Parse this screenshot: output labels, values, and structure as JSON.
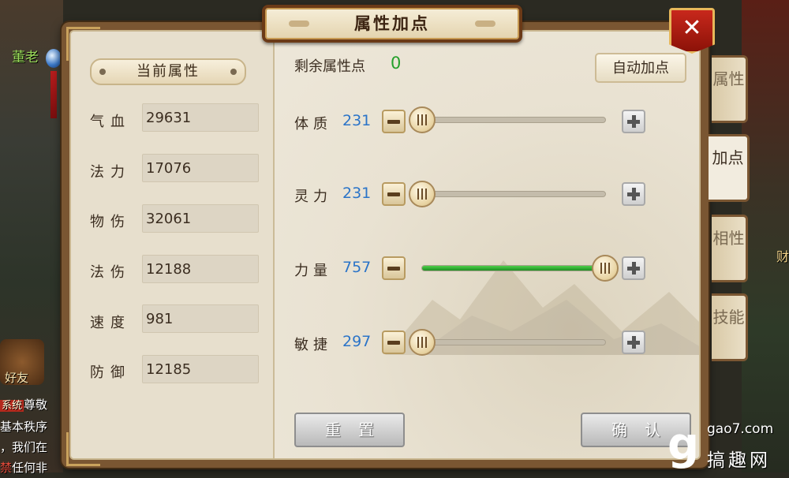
{
  "world": {
    "npc_name": "董老",
    "friend_label": "好友",
    "chat_lines": [
      {
        "tag": "系统",
        "text": "尊敬"
      },
      {
        "tag": "",
        "text": "基本秩序"
      },
      {
        "tag": "",
        "text": "，我们在"
      },
      {
        "tag": "禁",
        "text": "任何非"
      }
    ],
    "right_name": "财"
  },
  "title": "属性加点",
  "current_attrs": {
    "header": "当前属性",
    "items": [
      {
        "label": "气血",
        "value": "29631"
      },
      {
        "label": "法力",
        "value": "17076"
      },
      {
        "label": "物伤",
        "value": "32061"
      },
      {
        "label": "法伤",
        "value": "12188"
      },
      {
        "label": "速度",
        "value": "981"
      },
      {
        "label": "防御",
        "value": "12185"
      }
    ]
  },
  "points": {
    "remaining_label": "剩余属性点",
    "remaining_value": "0",
    "auto_button": "自动加点",
    "attributes": [
      {
        "label": "体质",
        "value": "231",
        "level": 0.0
      },
      {
        "label": "灵力",
        "value": "231",
        "level": 0.0
      },
      {
        "label": "力量",
        "value": "757",
        "level": 1.0
      },
      {
        "label": "敏捷",
        "value": "297",
        "level": 0.0
      }
    ],
    "reset_button": "重置",
    "confirm_button": "确认"
  },
  "tabs": [
    {
      "label": "属性",
      "active": false
    },
    {
      "label": "加点",
      "active": true
    },
    {
      "label": "相性",
      "active": false
    },
    {
      "label": "技能",
      "active": false
    }
  ],
  "close_label": "✕",
  "watermark": {
    "logo": "g",
    "site": "gao7.com",
    "cn": "搞趣网"
  },
  "colors": {
    "remaining_green": "#25a02b",
    "attr_value_blue": "#2b74c8",
    "slider_fill": "#2fae30",
    "panel_frame": "#7a5632"
  }
}
